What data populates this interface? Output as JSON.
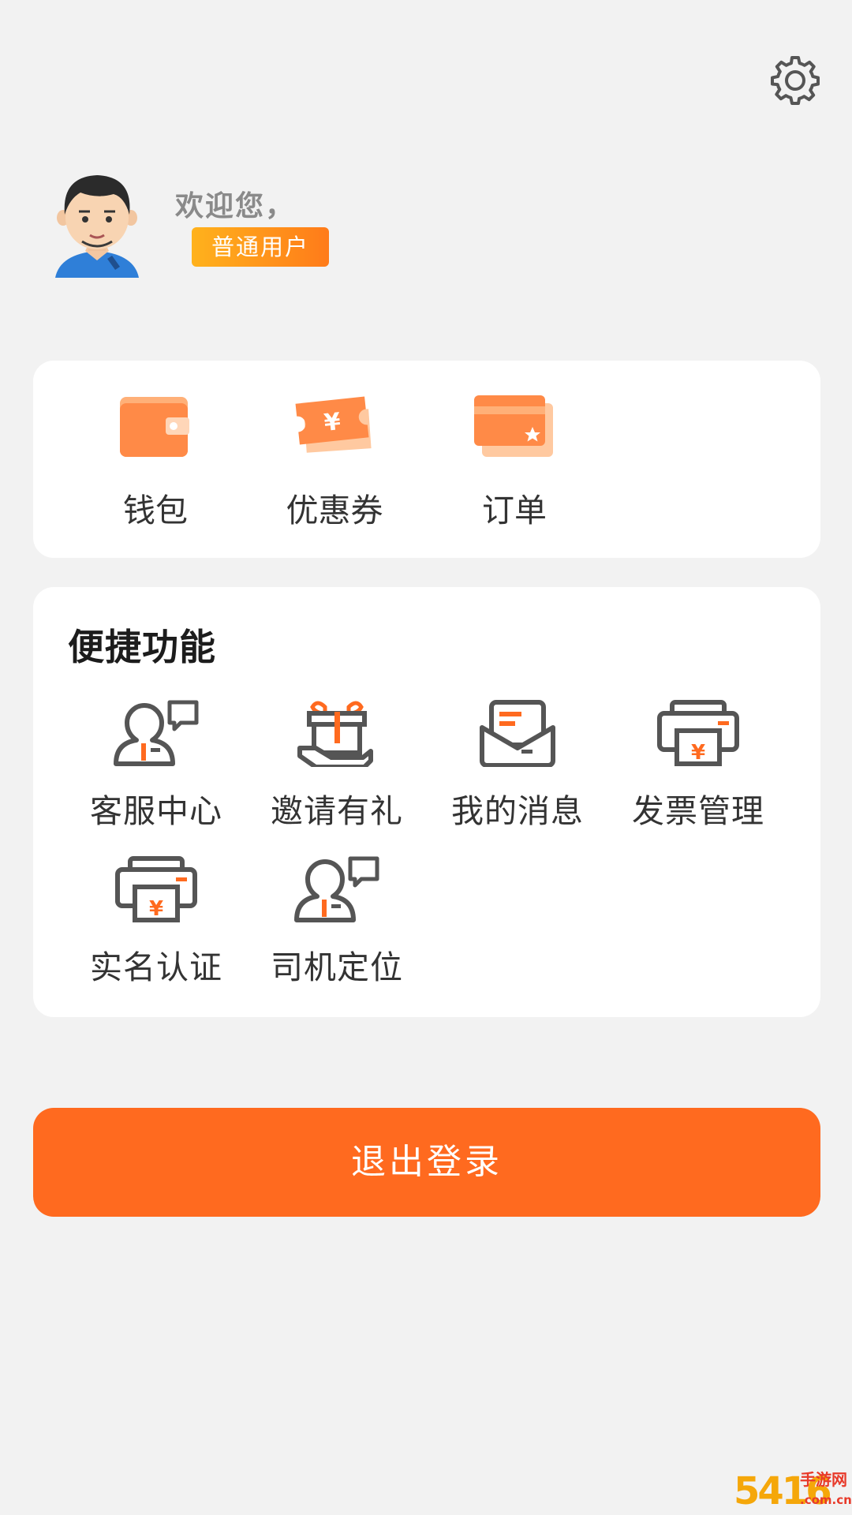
{
  "colors": {
    "accent": "#ff6a1f",
    "badge_start": "#ffb21c",
    "badge_end": "#ff7b1a",
    "background": "#f2f2f2",
    "icon_gray": "#555555"
  },
  "header": {
    "settings_icon": "gear-icon"
  },
  "profile": {
    "avatar_icon": "user-avatar",
    "welcome": "欢迎您，",
    "role": "普通用户"
  },
  "assets": [
    {
      "label": "钱包",
      "icon": "wallet-icon"
    },
    {
      "label": "优惠券",
      "icon": "coupon-icon"
    },
    {
      "label": "订单",
      "icon": "order-card-icon"
    }
  ],
  "quick": {
    "title": "便捷功能",
    "items": [
      {
        "label": "客服中心",
        "icon": "customer-service-icon"
      },
      {
        "label": "邀请有礼",
        "icon": "gift-icon"
      },
      {
        "label": "我的消息",
        "icon": "message-envelope-icon"
      },
      {
        "label": "发票管理",
        "icon": "invoice-printer-icon"
      },
      {
        "label": "实名认证",
        "icon": "id-verify-printer-icon"
      },
      {
        "label": "司机定位",
        "icon": "driver-location-icon"
      }
    ]
  },
  "logout": {
    "label": "退出登录"
  },
  "watermark": {
    "num": "5416",
    "cn": "手游网",
    "domain": ".com.cn"
  }
}
